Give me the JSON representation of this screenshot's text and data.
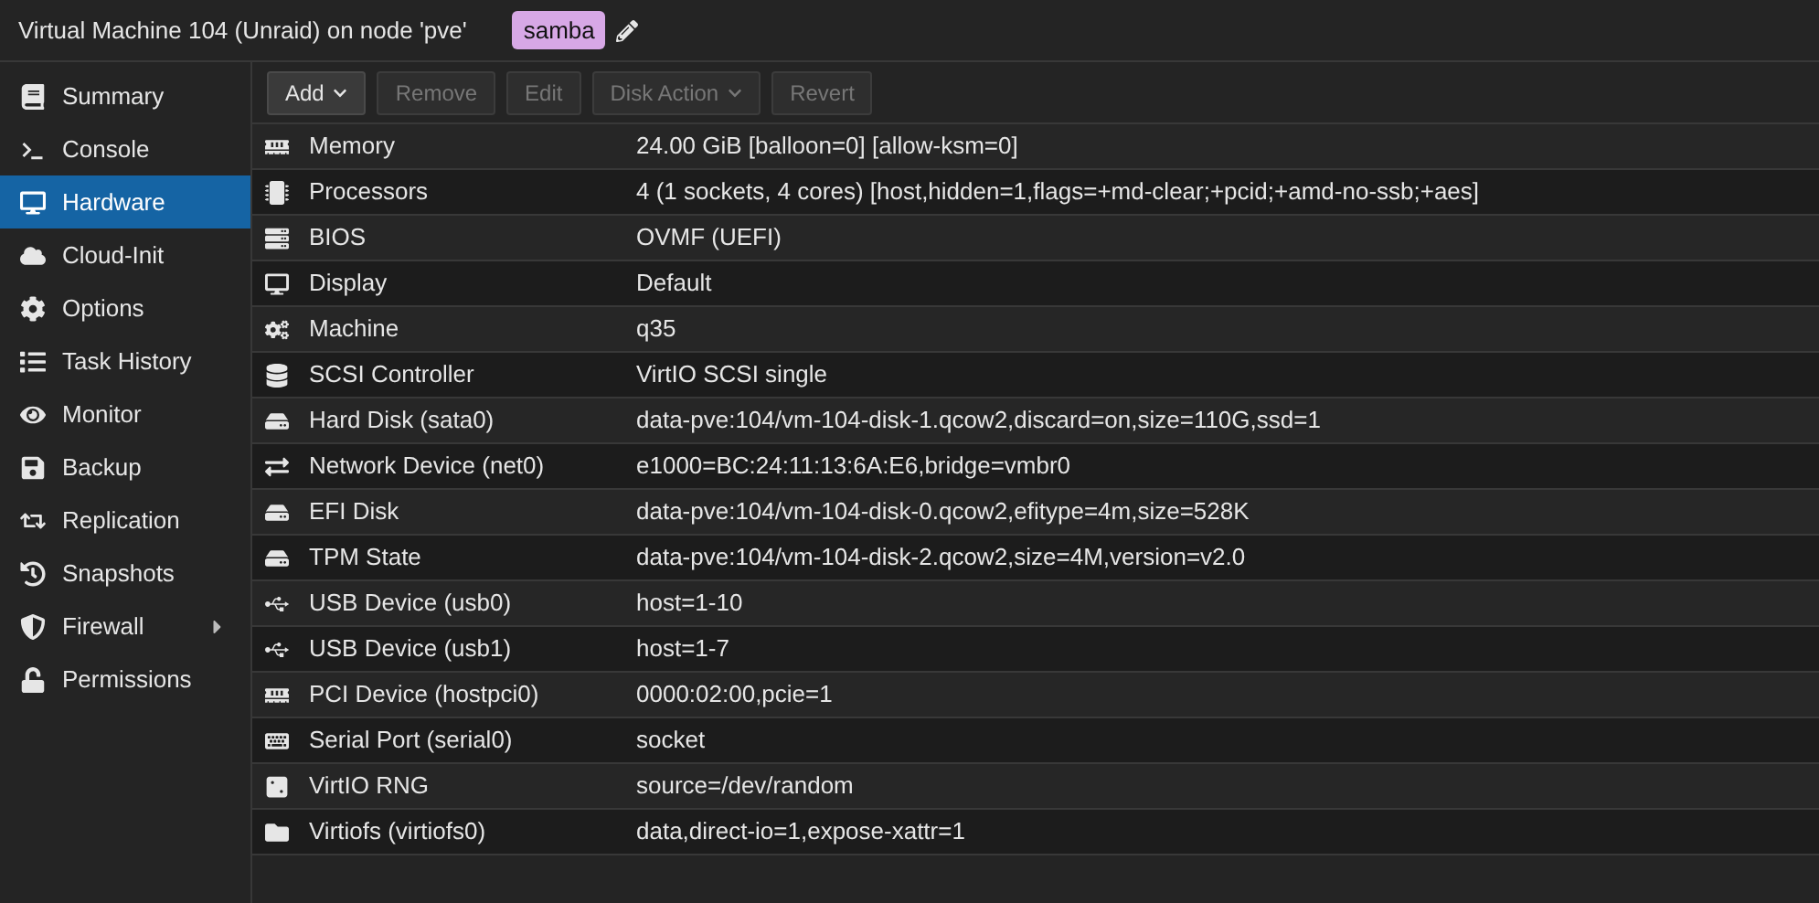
{
  "header": {
    "title": "Virtual Machine 104 (Unraid) on node 'pve'",
    "tag": "samba"
  },
  "sidebar": {
    "items": [
      {
        "label": "Summary",
        "selected": false
      },
      {
        "label": "Console",
        "selected": false
      },
      {
        "label": "Hardware",
        "selected": true
      },
      {
        "label": "Cloud-Init",
        "selected": false
      },
      {
        "label": "Options",
        "selected": false
      },
      {
        "label": "Task History",
        "selected": false
      },
      {
        "label": "Monitor",
        "selected": false
      },
      {
        "label": "Backup",
        "selected": false
      },
      {
        "label": "Replication",
        "selected": false
      },
      {
        "label": "Snapshots",
        "selected": false
      },
      {
        "label": "Firewall",
        "selected": false,
        "expandable": true
      },
      {
        "label": "Permissions",
        "selected": false
      }
    ]
  },
  "toolbar": [
    {
      "label": "Add",
      "disabled": false,
      "menu": true
    },
    {
      "label": "Remove",
      "disabled": true,
      "menu": false
    },
    {
      "label": "Edit",
      "disabled": true,
      "menu": false
    },
    {
      "label": "Disk Action",
      "disabled": true,
      "menu": true
    },
    {
      "label": "Revert",
      "disabled": true,
      "menu": false
    }
  ],
  "rows": [
    {
      "name": "Memory",
      "value": "24.00 GiB [balloon=0] [allow-ksm=0]"
    },
    {
      "name": "Processors",
      "value": "4 (1 sockets, 4 cores) [host,hidden=1,flags=+md-clear;+pcid;+amd-no-ssb;+aes]"
    },
    {
      "name": "BIOS",
      "value": "OVMF (UEFI)"
    },
    {
      "name": "Display",
      "value": "Default"
    },
    {
      "name": "Machine",
      "value": "q35"
    },
    {
      "name": "SCSI Controller",
      "value": "VirtIO SCSI single"
    },
    {
      "name": "Hard Disk (sata0)",
      "value": "data-pve:104/vm-104-disk-1.qcow2,discard=on,size=110G,ssd=1"
    },
    {
      "name": "Network Device (net0)",
      "value": "e1000=BC:24:11:13:6A:E6,bridge=vmbr0"
    },
    {
      "name": "EFI Disk",
      "value": "data-pve:104/vm-104-disk-0.qcow2,efitype=4m,size=528K"
    },
    {
      "name": "TPM State",
      "value": "data-pve:104/vm-104-disk-2.qcow2,size=4M,version=v2.0"
    },
    {
      "name": "USB Device (usb0)",
      "value": "host=1-10"
    },
    {
      "name": "USB Device (usb1)",
      "value": "host=1-7"
    },
    {
      "name": "PCI Device (hostpci0)",
      "value": "0000:02:00,pcie=1"
    },
    {
      "name": "Serial Port (serial0)",
      "value": "socket"
    },
    {
      "name": "VirtIO RNG",
      "value": "source=/dev/random"
    },
    {
      "name": "Virtiofs (virtiofs0)",
      "value": "data,direct-io=1,expose-xattr=1"
    }
  ]
}
